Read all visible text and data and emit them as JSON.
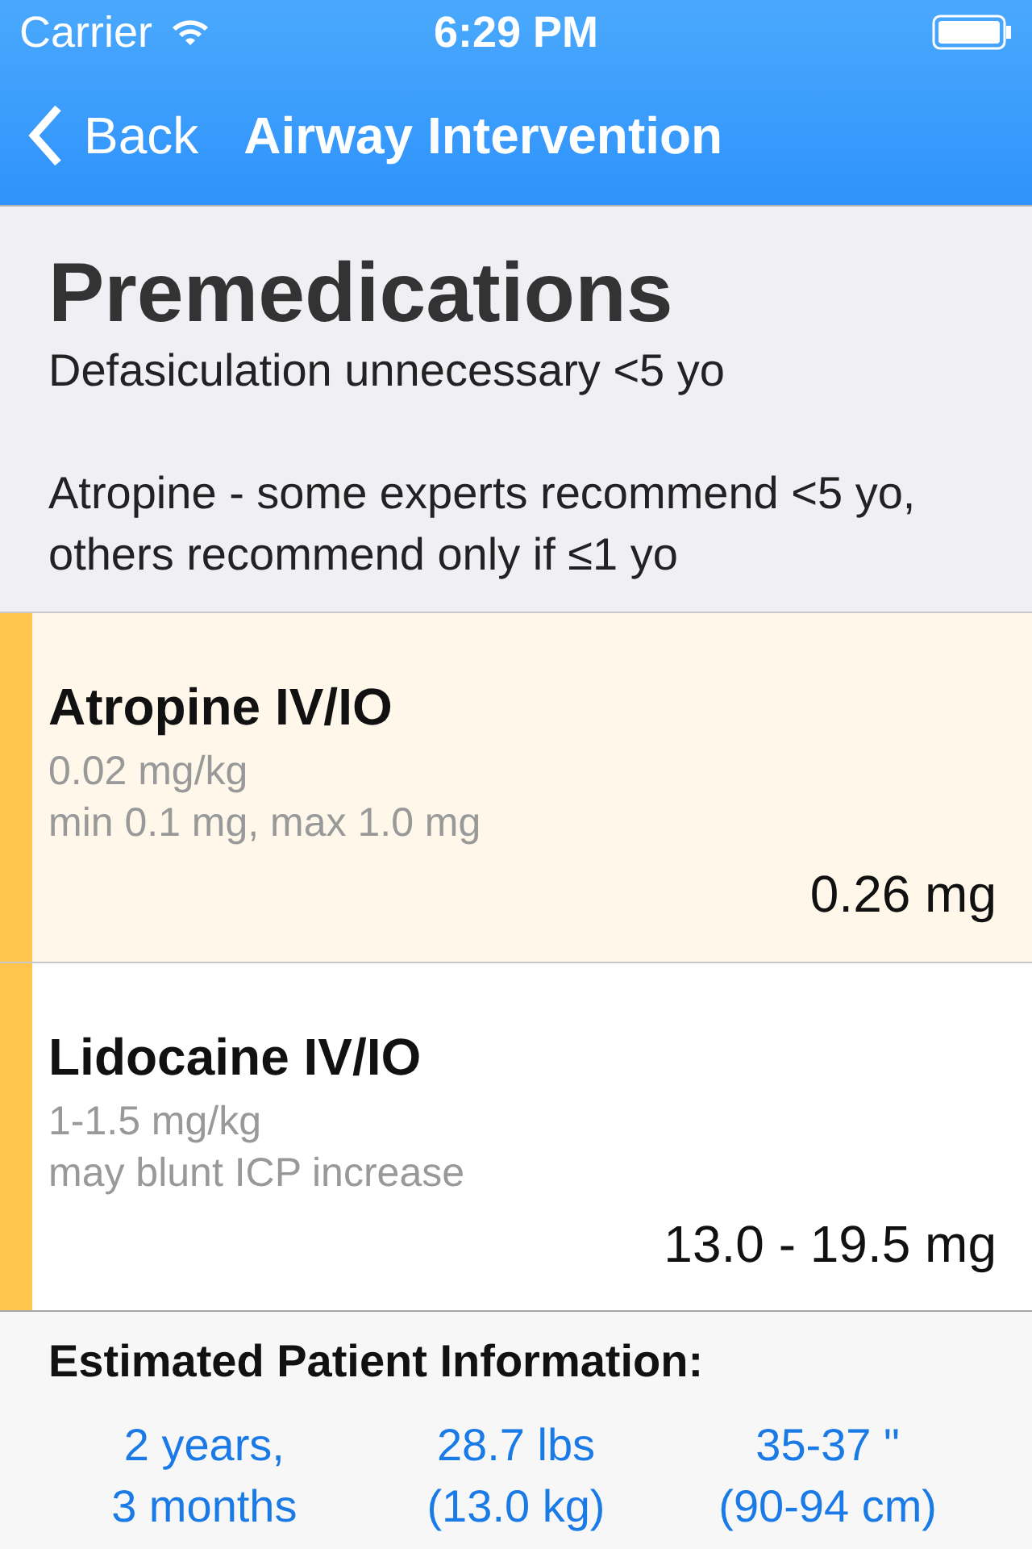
{
  "status_bar": {
    "carrier": "Carrier",
    "time": "6:29 PM"
  },
  "nav": {
    "back": "Back",
    "title": "Airway Intervention"
  },
  "header": {
    "title": "Premedications",
    "notes": [
      "Defasiculation unnecessary <5 yo",
      "Atropine - some experts recommend <5 yo, others recommend only if ≤1 yo"
    ]
  },
  "drugs": [
    {
      "name": "Atropine IV/IO",
      "details": [
        "0.02 mg/kg",
        "min 0.1 mg, max 1.0 mg"
      ],
      "dose": "0.26 mg",
      "selected": true
    },
    {
      "name": "Lidocaine IV/IO",
      "details": [
        "1-1.5 mg/kg",
        "may blunt ICP increase"
      ],
      "dose": "13.0 - 19.5 mg",
      "selected": false
    }
  ],
  "patient_info": {
    "title": "Estimated Patient Information:",
    "values": [
      [
        "2 years,",
        "3 months"
      ],
      [
        "28.7 lbs",
        "(13.0 kg)"
      ],
      [
        "35-37 \"",
        "(90-94 cm)"
      ]
    ]
  }
}
